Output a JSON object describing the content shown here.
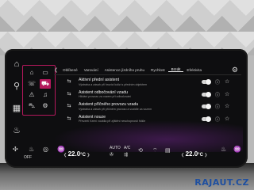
{
  "tabs": [
    {
      "label": "Oblíbené",
      "active": false
    },
    {
      "label": "Varování",
      "active": false
    },
    {
      "label": "Asistence jízdního pruhu",
      "active": false
    },
    {
      "label": "Rychlost",
      "active": false
    },
    {
      "label": "Brzdit",
      "active": true
    },
    {
      "label": "Efektivita",
      "active": false
    }
  ],
  "assist_items": [
    {
      "title": "Aktivní přední asistent",
      "subtitle": "Výstraha a zásah při hrozící kolizi s předním objektem",
      "enabled": true
    },
    {
      "title": "Asistent odbočování vzadu",
      "subtitle": "Hlídání provozu za vozem při odbočování",
      "enabled": true
    },
    {
      "title": "Asistent příčného provozu vzadu",
      "subtitle": "Výstraha a zásah při příčném provozu a vozidle za vozem",
      "enabled": true
    },
    {
      "title": "Asistent nouze",
      "subtitle": "Převzetí řízení vozidla při zjištění neschopnosti řidiče",
      "enabled": true
    }
  ],
  "climate": {
    "off_label": "OFF",
    "left_temp": "22.0",
    "left_temp_unit": "°C",
    "auto_label": "AUTO",
    "ac_label": "A/C",
    "right_temp": "22.0",
    "right_temp_unit": "°C"
  },
  "colors": {
    "accent": "#b4185c",
    "screen_bg": "#0e0e10"
  },
  "watermark": "RAJAUT.CZ"
}
